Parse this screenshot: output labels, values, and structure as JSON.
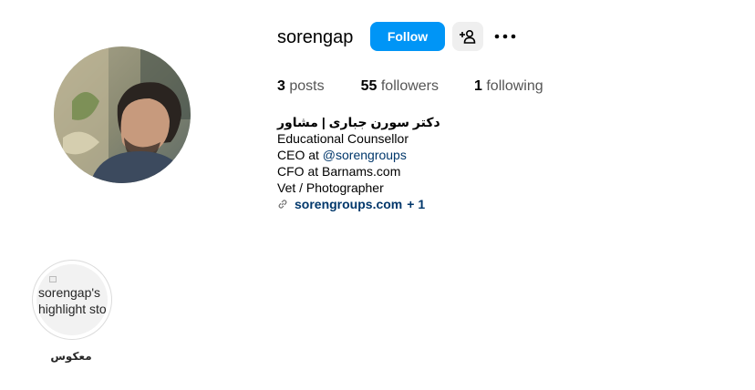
{
  "profile": {
    "username": "sorengap",
    "follow_label": "Follow",
    "add_user_icon": "add-user-icon",
    "more_icon": "more-options-icon"
  },
  "stats": {
    "posts_count": "3",
    "posts_label": "posts",
    "followers_count": "55",
    "followers_label": "followers",
    "following_count": "1",
    "following_label": "following"
  },
  "bio": {
    "name": "دکتر سورن جباری | مشاور",
    "line1": "Educational Counsellor",
    "line2_prefix": "CEO at ",
    "line2_mention": "@sorengroups",
    "line3": "CFO at Barnams.com",
    "line4": "Vet / Photographer",
    "link_icon": "link-icon",
    "link_text": "sorengroups.com",
    "link_more": "+ 1"
  },
  "highlights": [
    {
      "alt_text": "sorengap's highlight story",
      "title": "معکوس"
    }
  ],
  "colors": {
    "accent": "#0095f6",
    "link": "#00376b",
    "button_gray": "#efefef"
  }
}
